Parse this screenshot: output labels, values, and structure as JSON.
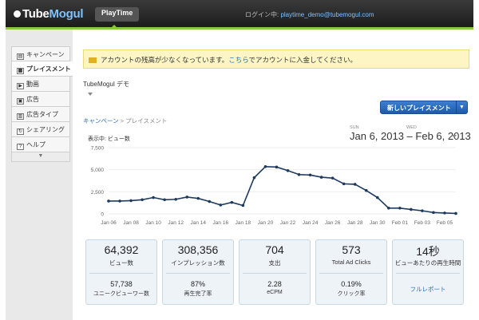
{
  "header": {
    "logo_prefix": "Tube",
    "logo_suffix": "Mogul",
    "app_tab": "PlayTime",
    "login_prefix": "ログイン中: ",
    "login_email": "playtime_demo@tubemogul.com"
  },
  "sidebar": {
    "items": [
      {
        "label": "キャンペーン",
        "icon": "campaign-icon"
      },
      {
        "label": "プレイスメント",
        "icon": "placement-icon",
        "active": true
      },
      {
        "label": "動画",
        "icon": "video-icon"
      },
      {
        "label": "広告",
        "icon": "ad-icon"
      },
      {
        "label": "広告タイプ",
        "icon": "ad-type-icon"
      },
      {
        "label": "シェアリング",
        "icon": "sharing-icon"
      },
      {
        "label": "ヘルプ",
        "icon": "help-icon"
      }
    ],
    "more_icon": "chevron-down-icon"
  },
  "alert": {
    "text_before": "アカウントの残高が少なくなっています。",
    "link": "こちら",
    "text_after": "でアカウントに入金してください。"
  },
  "account_name": "TubeMogul デモ",
  "new_button": "新しいプレイスメント",
  "breadcrumb": {
    "root": "キャンペーン",
    "sep": " > ",
    "current": "プレイスメント"
  },
  "daterange": {
    "from_day": "SUN",
    "to_day": "WED",
    "text": "Jan 6, 2013 – Feb 6, 2013"
  },
  "chart_label": "表示中: ビュー数",
  "chart_data": {
    "type": "line",
    "ylabel": "",
    "ylim": [
      0,
      7500
    ],
    "yticks": [
      "0",
      "2,500",
      "5,000",
      "7,500"
    ],
    "x_tick_labels": [
      "Jan 06",
      "Jan 08",
      "Jan 10",
      "Jan 12",
      "Jan 14",
      "Jan 16",
      "Jan 18",
      "Jan 20",
      "Jan 22",
      "Jan 24",
      "Jan 26",
      "Jan 28",
      "Jan 30",
      "Feb 01",
      "Feb 03",
      "Feb 05"
    ],
    "series": [
      {
        "color": "#1f3a5f",
        "values": [
          1450,
          1450,
          1500,
          1600,
          1850,
          1600,
          1650,
          1900,
          1750,
          1400,
          1000,
          1300,
          950,
          4100,
          5350,
          5300,
          4900,
          4450,
          4400,
          4150,
          4050,
          3400,
          3350,
          2650,
          1850,
          650,
          650,
          500,
          350,
          150,
          100,
          50
        ]
      }
    ]
  },
  "stats": [
    {
      "value": "64,392",
      "label": "ビュー数",
      "sub_value": "57,738",
      "sub_label": "ユニークビューワー数"
    },
    {
      "value": "308,356",
      "label": "インプレッション数",
      "sub_value": "87%",
      "sub_label": "再生完了率"
    },
    {
      "value": "704",
      "label": "支出",
      "sub_value": "2.28",
      "sub_label": "eCPM"
    },
    {
      "value": "573",
      "label": "Total Ad Clicks",
      "sub_value": "0.19%",
      "sub_label": "クリック率"
    },
    {
      "value": "14秒",
      "label": "ビューあたりの再生時間",
      "link": "フルレポート"
    }
  ]
}
